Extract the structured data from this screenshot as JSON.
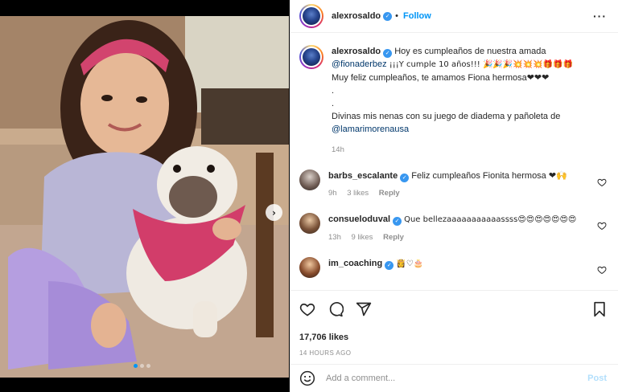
{
  "post": {
    "username": "alexrosaldo",
    "follow_label": "Follow",
    "more_icon": "more-icon"
  },
  "caption": {
    "username": "alexrosaldo",
    "line1": "Hoy es cumpleaños de nuestra amada",
    "mention1": "@fionaderbez",
    "line2": "¡¡¡Y cumple 10 años!!! 🎉🎉🎉💥💥💥🎁🎁🎁",
    "line3": "Muy feliz cumpleaños, te amamos Fiona hermosa❤❤❤",
    "dot1": ".",
    "dot2": ".",
    "line4": "Divinas mis nenas con su juego de diadema y pañoleta de",
    "mention2": "@lamarimorenausa",
    "time": "14h"
  },
  "comments": [
    {
      "username": "barbs_escalante",
      "text": "Feliz cumpleaños Fionita hermosa ❤🙌",
      "time": "9h",
      "likes": "3 likes",
      "reply": "Reply"
    },
    {
      "username": "consueloduval",
      "text": "Que bellezaaaaaaaaaaassss😍😍😍😍😍😍😍",
      "time": "13h",
      "likes": "9 likes",
      "reply": "Reply"
    },
    {
      "username": "im_coaching",
      "text": "👸♡🎂"
    }
  ],
  "actions": {
    "likes": "17,706 likes",
    "time_ago": "14 HOURS AGO"
  },
  "add_comment": {
    "placeholder": "Add a comment...",
    "post_label": "Post"
  },
  "carousel": {
    "slides": 3,
    "active": 1
  },
  "colors": {
    "link_blue": "#0095f6",
    "mention": "#00376b",
    "verified": "#3897f0",
    "heart_red": "#ed4956",
    "muted": "#8e8e8e"
  }
}
